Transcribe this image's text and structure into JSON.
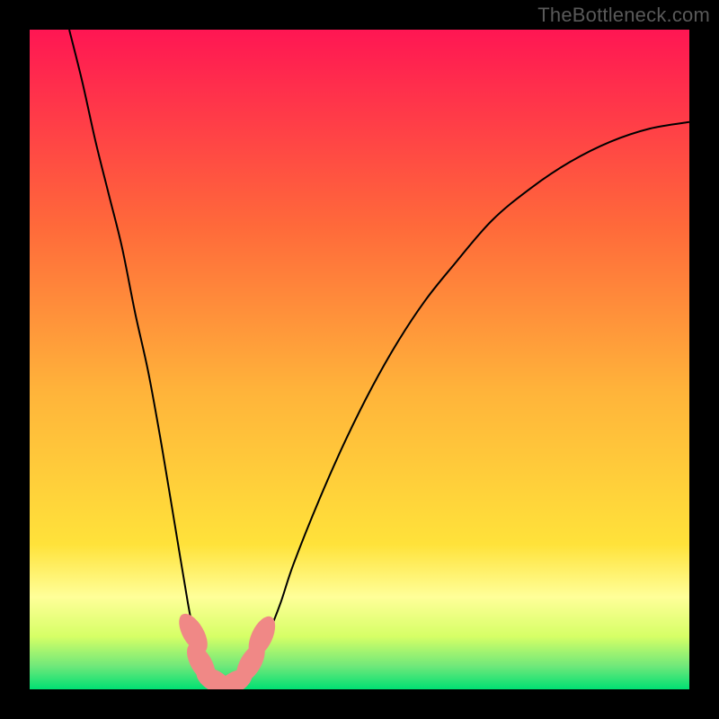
{
  "watermark": "TheBottleneck.com",
  "colors": {
    "gradient_top": "#ff1653",
    "gradient_mid": "#ffd23a",
    "gradient_band": "#ffff99",
    "gradient_bottom": "#00e073",
    "curve": "#000000",
    "marker": "#f08886",
    "frame": "#000000"
  },
  "chart_data": {
    "type": "line",
    "title": "",
    "xlabel": "",
    "ylabel": "",
    "xlim": [
      0,
      100
    ],
    "ylim": [
      0,
      100
    ],
    "series": [
      {
        "name": "bottleneck-curve",
        "x": [
          6,
          8,
          10,
          12,
          14,
          16,
          18,
          20,
          22,
          24,
          25,
          26,
          27,
          28,
          29,
          30,
          31,
          32,
          33,
          34,
          36,
          38,
          40,
          44,
          48,
          52,
          56,
          60,
          64,
          70,
          76,
          82,
          88,
          94,
          100
        ],
        "values": [
          100,
          92,
          83,
          75,
          67,
          57,
          48,
          37,
          25,
          13,
          8,
          4,
          2,
          1,
          0.6,
          0.5,
          0.6,
          1,
          2,
          4,
          8,
          13,
          19,
          29,
          38,
          46,
          53,
          59,
          64,
          71,
          76,
          80,
          83,
          85,
          86
        ]
      }
    ],
    "markers": [
      {
        "x": 24.8,
        "y": 8.5,
        "rx": 1.6,
        "ry": 3.3,
        "angle": -30
      },
      {
        "x": 26.0,
        "y": 4.0,
        "rx": 1.6,
        "ry": 3.3,
        "angle": -30
      },
      {
        "x": 28.0,
        "y": 1.3,
        "rx": 1.6,
        "ry": 3.0,
        "angle": -60
      },
      {
        "x": 31.0,
        "y": 1.0,
        "rx": 1.6,
        "ry": 3.0,
        "angle": 60
      },
      {
        "x": 33.5,
        "y": 4.0,
        "rx": 1.6,
        "ry": 3.3,
        "angle": 30
      },
      {
        "x": 35.2,
        "y": 8.0,
        "rx": 1.6,
        "ry": 3.3,
        "angle": 25
      }
    ],
    "gradient_stops": [
      {
        "offset": 0,
        "color": "#ff1653"
      },
      {
        "offset": 0.3,
        "color": "#ff6a3a"
      },
      {
        "offset": 0.55,
        "color": "#ffb43a"
      },
      {
        "offset": 0.78,
        "color": "#ffe23a"
      },
      {
        "offset": 0.86,
        "color": "#ffff99"
      },
      {
        "offset": 0.92,
        "color": "#d6ff66"
      },
      {
        "offset": 0.965,
        "color": "#6fe87a"
      },
      {
        "offset": 1.0,
        "color": "#00e073"
      }
    ]
  }
}
